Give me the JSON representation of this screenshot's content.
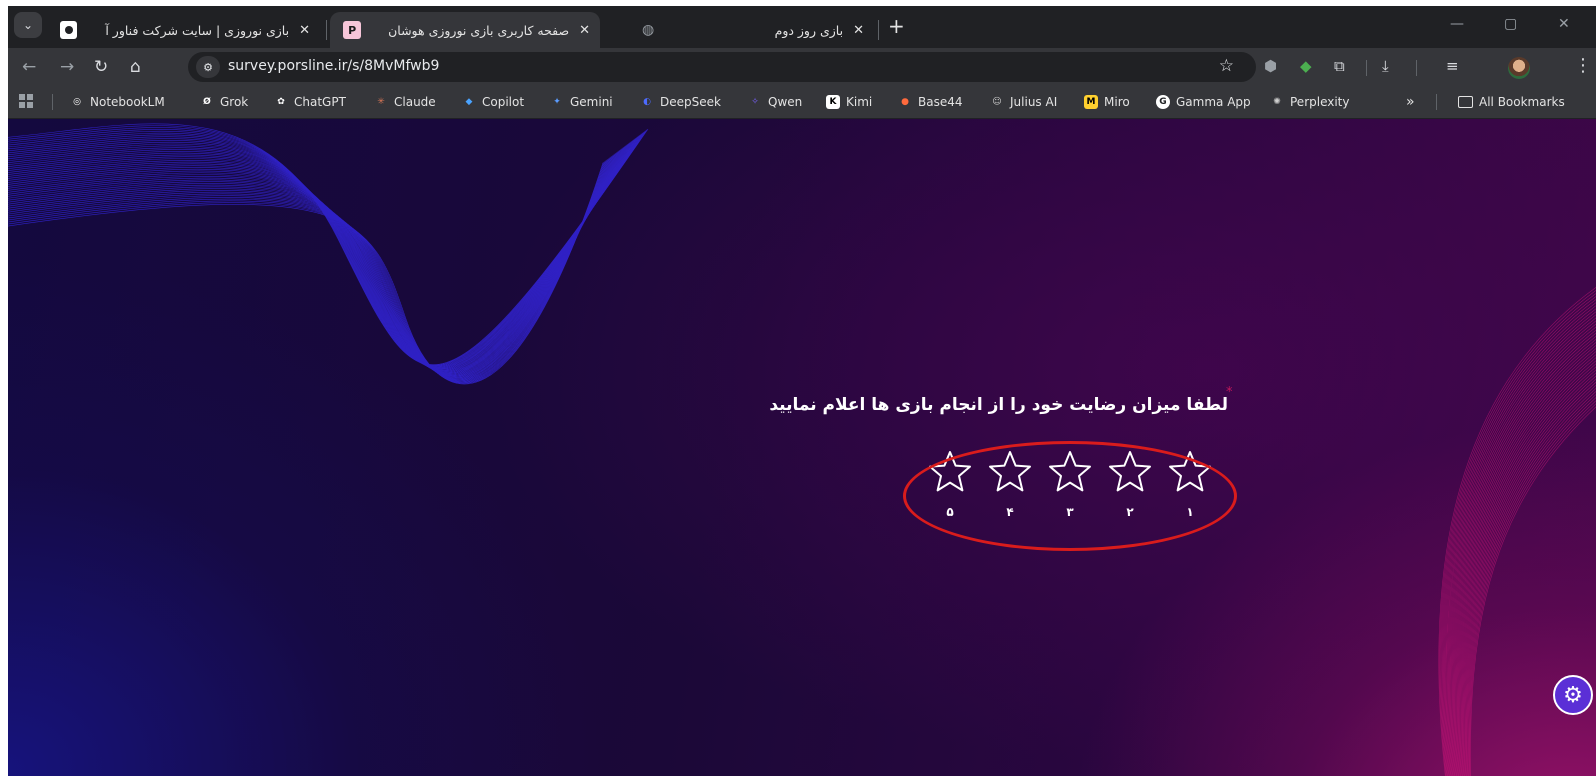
{
  "tabs": [
    {
      "title": "بازی نوروزی | سایت شرکت فناور آ",
      "favicon_text": "",
      "active": false
    },
    {
      "title": "صفحه کاربری بازی نوروزی هوشان",
      "favicon_text": "P",
      "active": true
    },
    {
      "title": "بازی روز دوم",
      "favicon_text": "",
      "active": false
    }
  ],
  "tab_close_glyph": "✕",
  "tab_menu_glyph": "⌄",
  "new_tab_glyph": "+",
  "window_controls": {
    "minimize": "—",
    "restore": "▢",
    "close": "✕"
  },
  "toolbar": {
    "back": "←",
    "forward": "→",
    "reload": "↻",
    "home": "⌂",
    "site_info_glyph": "⚙",
    "url": "survey.porsline.ir/s/8MvMfwb9",
    "bookmark_star": "☆",
    "download_glyph": "⤓",
    "reading_list_glyph": "≡",
    "menu_glyph": "⋮"
  },
  "bookmarks": [
    {
      "label": "NotebookLM",
      "icon": "notebooklm-icon",
      "color": "#ffffff",
      "glyph": "◎"
    },
    {
      "label": "Grok",
      "icon": "grok-icon",
      "color": "#ffffff",
      "glyph": "Ø"
    },
    {
      "label": "ChatGPT",
      "icon": "chatgpt-icon",
      "color": "#ffffff",
      "glyph": "✿"
    },
    {
      "label": "Claude",
      "icon": "claude-icon",
      "color": "#d97757",
      "glyph": "✳"
    },
    {
      "label": "Copilot",
      "icon": "copilot-icon",
      "color": "#4aa3ff",
      "glyph": "◆"
    },
    {
      "label": "Gemini",
      "icon": "gemini-icon",
      "color": "#5b9cff",
      "glyph": "✦"
    },
    {
      "label": "DeepSeek",
      "icon": "deepseek-icon",
      "color": "#4d6bfe",
      "glyph": "◐"
    },
    {
      "label": "Qwen",
      "icon": "qwen-icon",
      "color": "#7b61ff",
      "glyph": "✧"
    },
    {
      "label": "Kimi",
      "icon": "kimi-icon",
      "color": "#ffffff",
      "glyph": "K"
    },
    {
      "label": "Base44",
      "icon": "base44-icon",
      "color": "#ff6a3d",
      "glyph": "●"
    },
    {
      "label": "Julius AI",
      "icon": "julius-icon",
      "color": "#cfcfcf",
      "glyph": "☺"
    },
    {
      "label": "Miro",
      "icon": "miro-icon",
      "color": "#ffd02f",
      "glyph": "M"
    },
    {
      "label": "Gamma App",
      "icon": "gamma-icon",
      "color": "#ffffff",
      "glyph": "G"
    },
    {
      "label": "Perplexity",
      "icon": "perplexity-icon",
      "color": "#cfcfcf",
      "glyph": "✺"
    }
  ],
  "bookmarks_overflow": "»",
  "all_bookmarks": "All Bookmarks",
  "survey": {
    "required_mark": "*",
    "question": "لطفا میزان رضایت خود را از انجام بازی ها اعلام نمایید",
    "rating_labels": [
      "۱",
      "۲",
      "۳",
      "۴",
      "۵"
    ],
    "rating_value": 0,
    "rating_max": 5
  },
  "colors": {
    "highlight": "#d91c1c",
    "accent": "#5b2fd6",
    "required": "#c2185b"
  }
}
